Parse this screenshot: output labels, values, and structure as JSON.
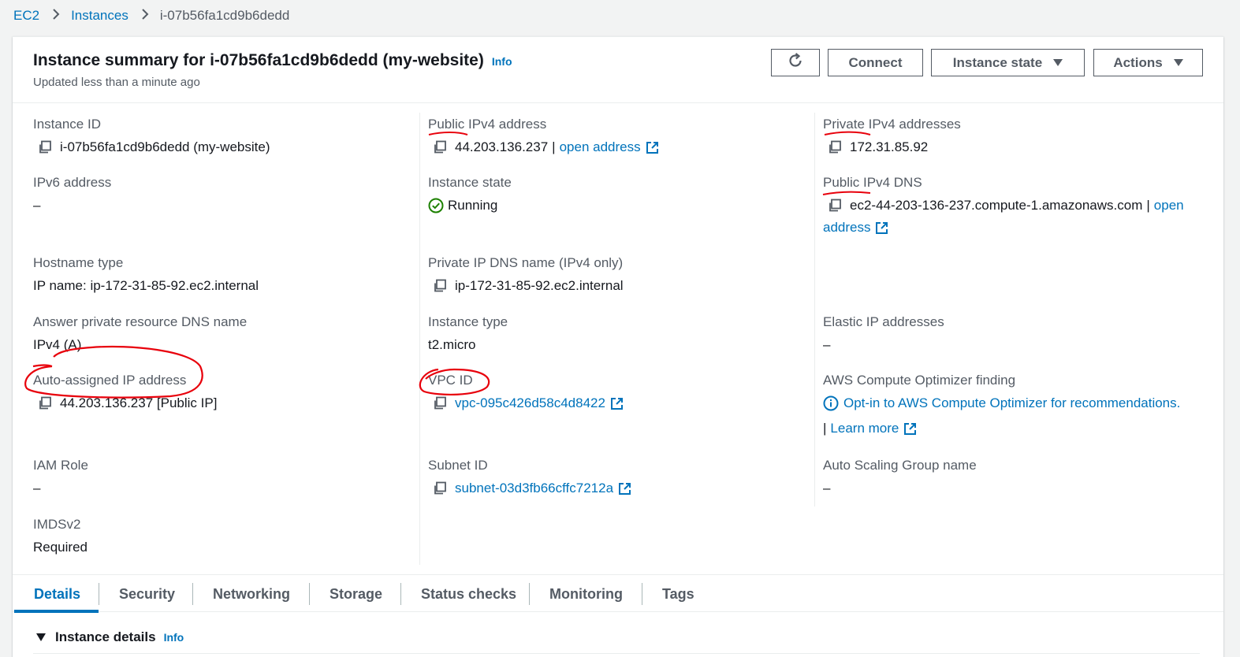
{
  "breadcrumb": {
    "root": "EC2",
    "instances": "Instances",
    "current": "i-07b56fa1cd9b6dedd"
  },
  "header": {
    "title": "Instance summary for i-07b56fa1cd9b6dedd (my-website)",
    "info": "Info",
    "subtitle": "Updated less than a minute ago",
    "connect_label": "Connect",
    "instance_state_label": "Instance state",
    "actions_label": "Actions"
  },
  "fields": {
    "instance_id": {
      "label": "Instance ID",
      "value": "i-07b56fa1cd9b6dedd (my-website)"
    },
    "ipv6": {
      "label": "IPv6 address",
      "value": "–"
    },
    "hostname_type": {
      "label": "Hostname type",
      "value": "IP name: ip-172-31-85-92.ec2.internal"
    },
    "answer_dns": {
      "label": "Answer private resource DNS name",
      "value": "IPv4 (A)"
    },
    "auto_ip": {
      "label": "Auto-assigned IP address",
      "value": "44.203.136.237 [Public IP]"
    },
    "iam_role": {
      "label": "IAM Role",
      "value": "–"
    },
    "imdsv2": {
      "label": "IMDSv2",
      "value": "Required"
    },
    "public_ipv4": {
      "label": "Public IPv4 address",
      "value": "44.203.136.237",
      "sep": "|",
      "link": "open address"
    },
    "instance_state": {
      "label": "Instance state",
      "value": "Running"
    },
    "private_dns": {
      "label": "Private IP DNS name (IPv4 only)",
      "value": "ip-172-31-85-92.ec2.internal"
    },
    "instance_type": {
      "label": "Instance type",
      "value": "t2.micro"
    },
    "vpc_id": {
      "label": "VPC ID",
      "value": "vpc-095c426d58c4d8422"
    },
    "subnet_id": {
      "label": "Subnet ID",
      "value": "subnet-03d3fb66cffc7212a"
    },
    "private_ipv4": {
      "label": "Private IPv4 addresses",
      "value": "172.31.85.92"
    },
    "public_dns": {
      "label": "Public IPv4 DNS",
      "value": "ec2-44-203-136-237.compute-1.amazonaws.com",
      "sep": "|",
      "link_part1": "open",
      "link_part2": "address"
    },
    "elastic_ip": {
      "label": "Elastic IP addresses",
      "value": "–"
    },
    "optimizer": {
      "label": "AWS Compute Optimizer finding",
      "link": "Opt-in to AWS Compute Optimizer for recommendations.",
      "sep": "|",
      "learn_more": "Learn more"
    },
    "asg_name": {
      "label": "Auto Scaling Group name",
      "value": "–"
    }
  },
  "tabs": [
    "Details",
    "Security",
    "Networking",
    "Storage",
    "Status checks",
    "Monitoring",
    "Tags"
  ],
  "section": {
    "title": "Instance details",
    "info": "Info"
  },
  "colors": {
    "link": "#0073bb",
    "running": "#1d8102",
    "annotation": "#e8000b"
  }
}
